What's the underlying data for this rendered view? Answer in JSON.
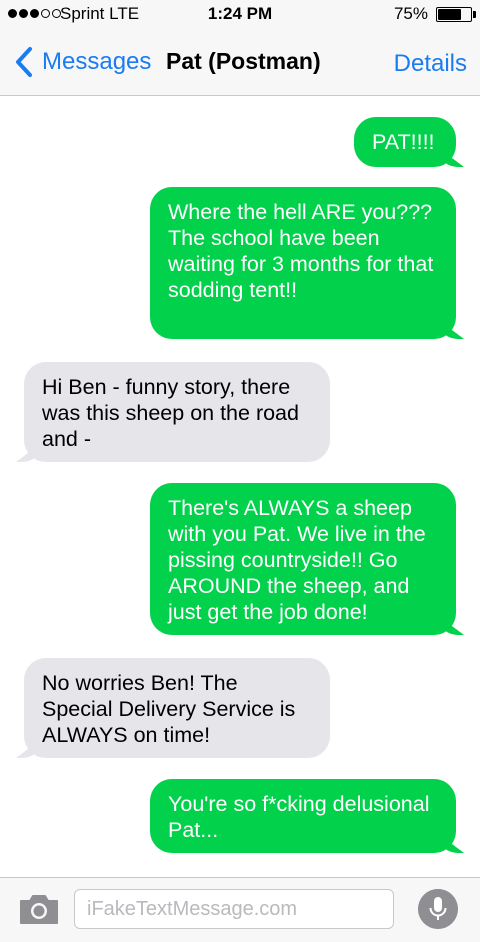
{
  "status_bar": {
    "carrier": "Sprint  LTE",
    "time": "1:24 PM",
    "battery_percent": "75%",
    "battery_level": 0.75,
    "signal_bars_filled": 3,
    "signal_bars_total": 5
  },
  "nav": {
    "back_label": "Messages",
    "title": "Pat (Postman)",
    "details_label": "Details",
    "accent_color": "#1a7cf0"
  },
  "messages": [
    {
      "direction": "sent",
      "text": "PAT!!!!"
    },
    {
      "direction": "sent",
      "text": "Where the hell ARE you??? The school have been waiting for 3 months for that sodding tent!!"
    },
    {
      "direction": "received",
      "text": "Hi Ben - funny story, there was this sheep on the road and -"
    },
    {
      "direction": "sent",
      "text": "There's ALWAYS a sheep with you Pat. We live in the pissing countryside!! Go AROUND the sheep, and just get the job done!"
    },
    {
      "direction": "received",
      "text": "No worries Ben! The Special Delivery Service is ALWAYS on time!"
    },
    {
      "direction": "sent",
      "text": "You're so f*cking delusional Pat..."
    }
  ],
  "colors": {
    "sent_bubble": "#02d14b",
    "received_bubble": "#e5e5ea"
  },
  "input_bar": {
    "placeholder": "iFakeTextMessage.com",
    "camera_icon": "camera-icon",
    "mic_icon": "microphone-icon"
  }
}
